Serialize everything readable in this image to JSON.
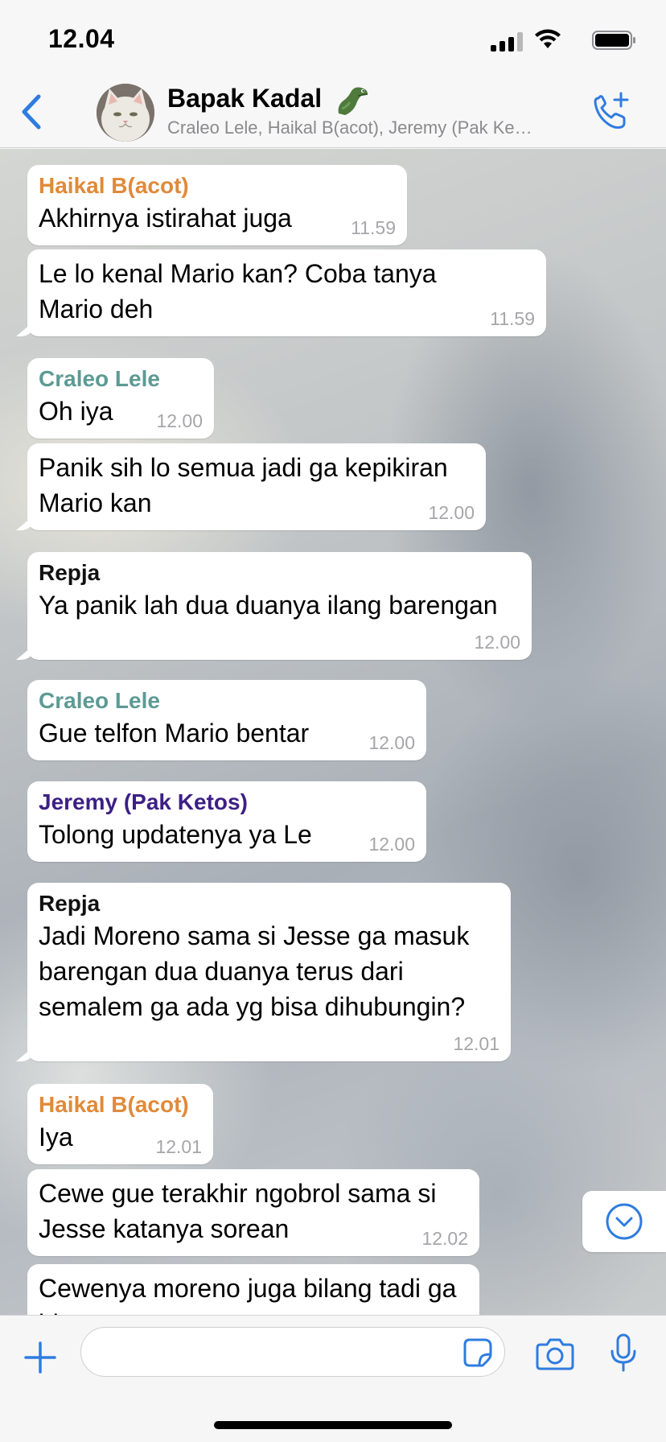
{
  "status_bar": {
    "time": "12.04"
  },
  "header": {
    "title": "Bapak Kadal",
    "members": "Craleo Lele, Haikal B(acot), Jeremy (Pak Ke…"
  },
  "messages": [
    {
      "sender": "Haikal B(acot)",
      "text": "Akhirnya istirahat juga",
      "time": "11.59"
    },
    {
      "sender": "",
      "text": "Le lo kenal Mario kan? Coba tanya Mario deh",
      "time": "11.59"
    },
    {
      "sender": "Craleo Lele",
      "text": "Oh iya",
      "time": "12.00"
    },
    {
      "sender": "",
      "text": "Panik sih lo semua jadi ga kepikiran Mario kan",
      "time": "12.00"
    },
    {
      "sender": "Repja",
      "text": "Ya panik lah dua duanya ilang barengan",
      "time": "12.00"
    },
    {
      "sender": "Craleo Lele",
      "text": "Gue telfon Mario bentar",
      "time": "12.00"
    },
    {
      "sender": "Jeremy (Pak Ketos)",
      "text": "Tolong updatenya ya Le",
      "time": "12.00"
    },
    {
      "sender": "Repja",
      "text": "Jadi Moreno sama si Jesse ga masuk barengan dua duanya terus dari semalem ga ada yg bisa dihubungin?",
      "time": "12.01"
    },
    {
      "sender": "Haikal B(acot)",
      "text": "Iya",
      "time": "12.01"
    },
    {
      "sender": "",
      "text": "Cewe gue terakhir ngobrol sama si Jesse katanya sorean",
      "time": "12.02"
    },
    {
      "sender": "",
      "text": "Cewenya moreno juga bilang tadi ga bisa..",
      "time": ""
    }
  ],
  "sender_colors": {
    "haikal": "#e08a3a",
    "craleo": "#5d9a94",
    "repja": "#111111",
    "jeremy": "#3d1f86"
  },
  "input": {
    "placeholder": "",
    "value": ""
  },
  "accent_color": "#2f7ce0"
}
